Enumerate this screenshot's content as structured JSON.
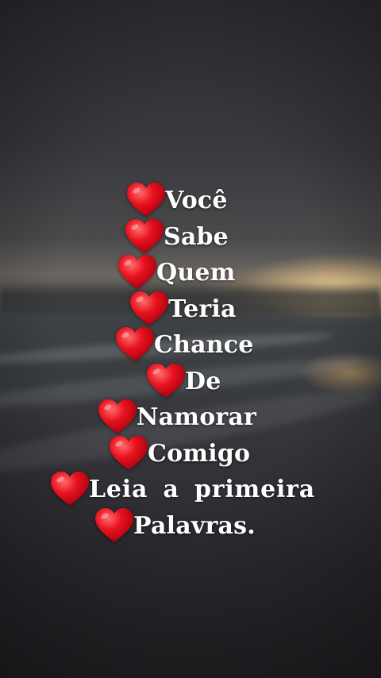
{
  "background": {
    "description_colors": {
      "sky_top": "#2f2f36",
      "horizon": "#6a6660",
      "sun_glow": "#ffd68c",
      "sea": "#3a3d40",
      "sand": "#262529"
    }
  },
  "heart_color": "#e8121f",
  "text_color": "#ffffff",
  "lines": [
    {
      "text": "Você"
    },
    {
      "text": "Sabe"
    },
    {
      "text": "Quem"
    },
    {
      "text": "Teria"
    },
    {
      "text": "Chance"
    },
    {
      "text": "De"
    },
    {
      "text": "Namorar"
    },
    {
      "text": "Comigo"
    },
    {
      "text": "Leia  a  primeira"
    },
    {
      "text": "Palavras."
    }
  ],
  "icons": {
    "heart": "red-heart-icon"
  }
}
